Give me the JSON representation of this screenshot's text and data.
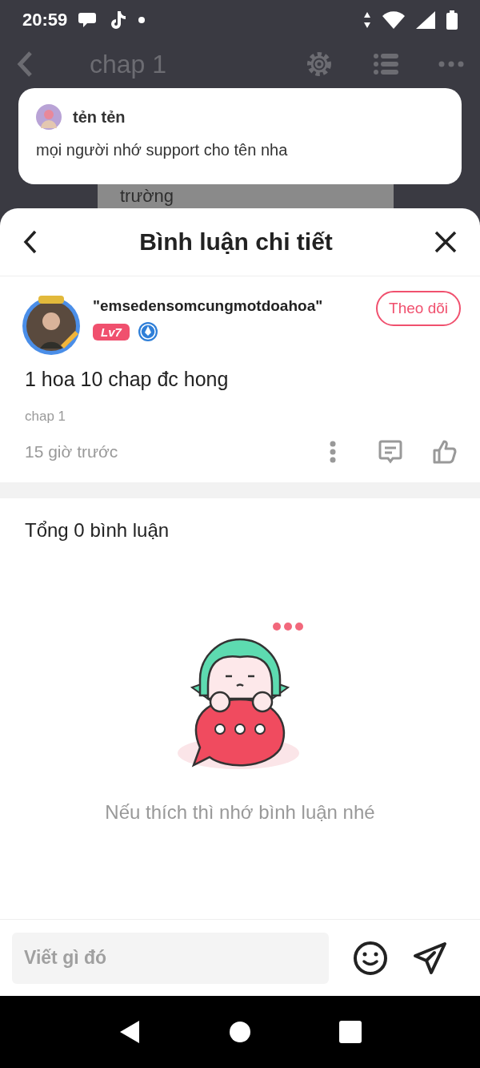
{
  "status_bar": {
    "time": "20:59"
  },
  "app_bar": {
    "title": "chap 1"
  },
  "background_text": "trường",
  "toast": {
    "user": "tẻn tẻn",
    "message": "mọi người nhớ support cho tên nha"
  },
  "sheet": {
    "title": "Bình luận chi tiết"
  },
  "comment": {
    "author": "\"emsedensomcungmotdoahoa\"",
    "level": "Lv7",
    "follow": "Theo dõi",
    "text": "1 hoa 10 chap đc hong",
    "chapter": "chap 1",
    "time": "15 giờ trước"
  },
  "total": "Tổng 0 bình luận",
  "empty_message": "Nếu thích thì nhớ bình luận nhé",
  "composer": {
    "placeholder": "Viết gì đó"
  }
}
